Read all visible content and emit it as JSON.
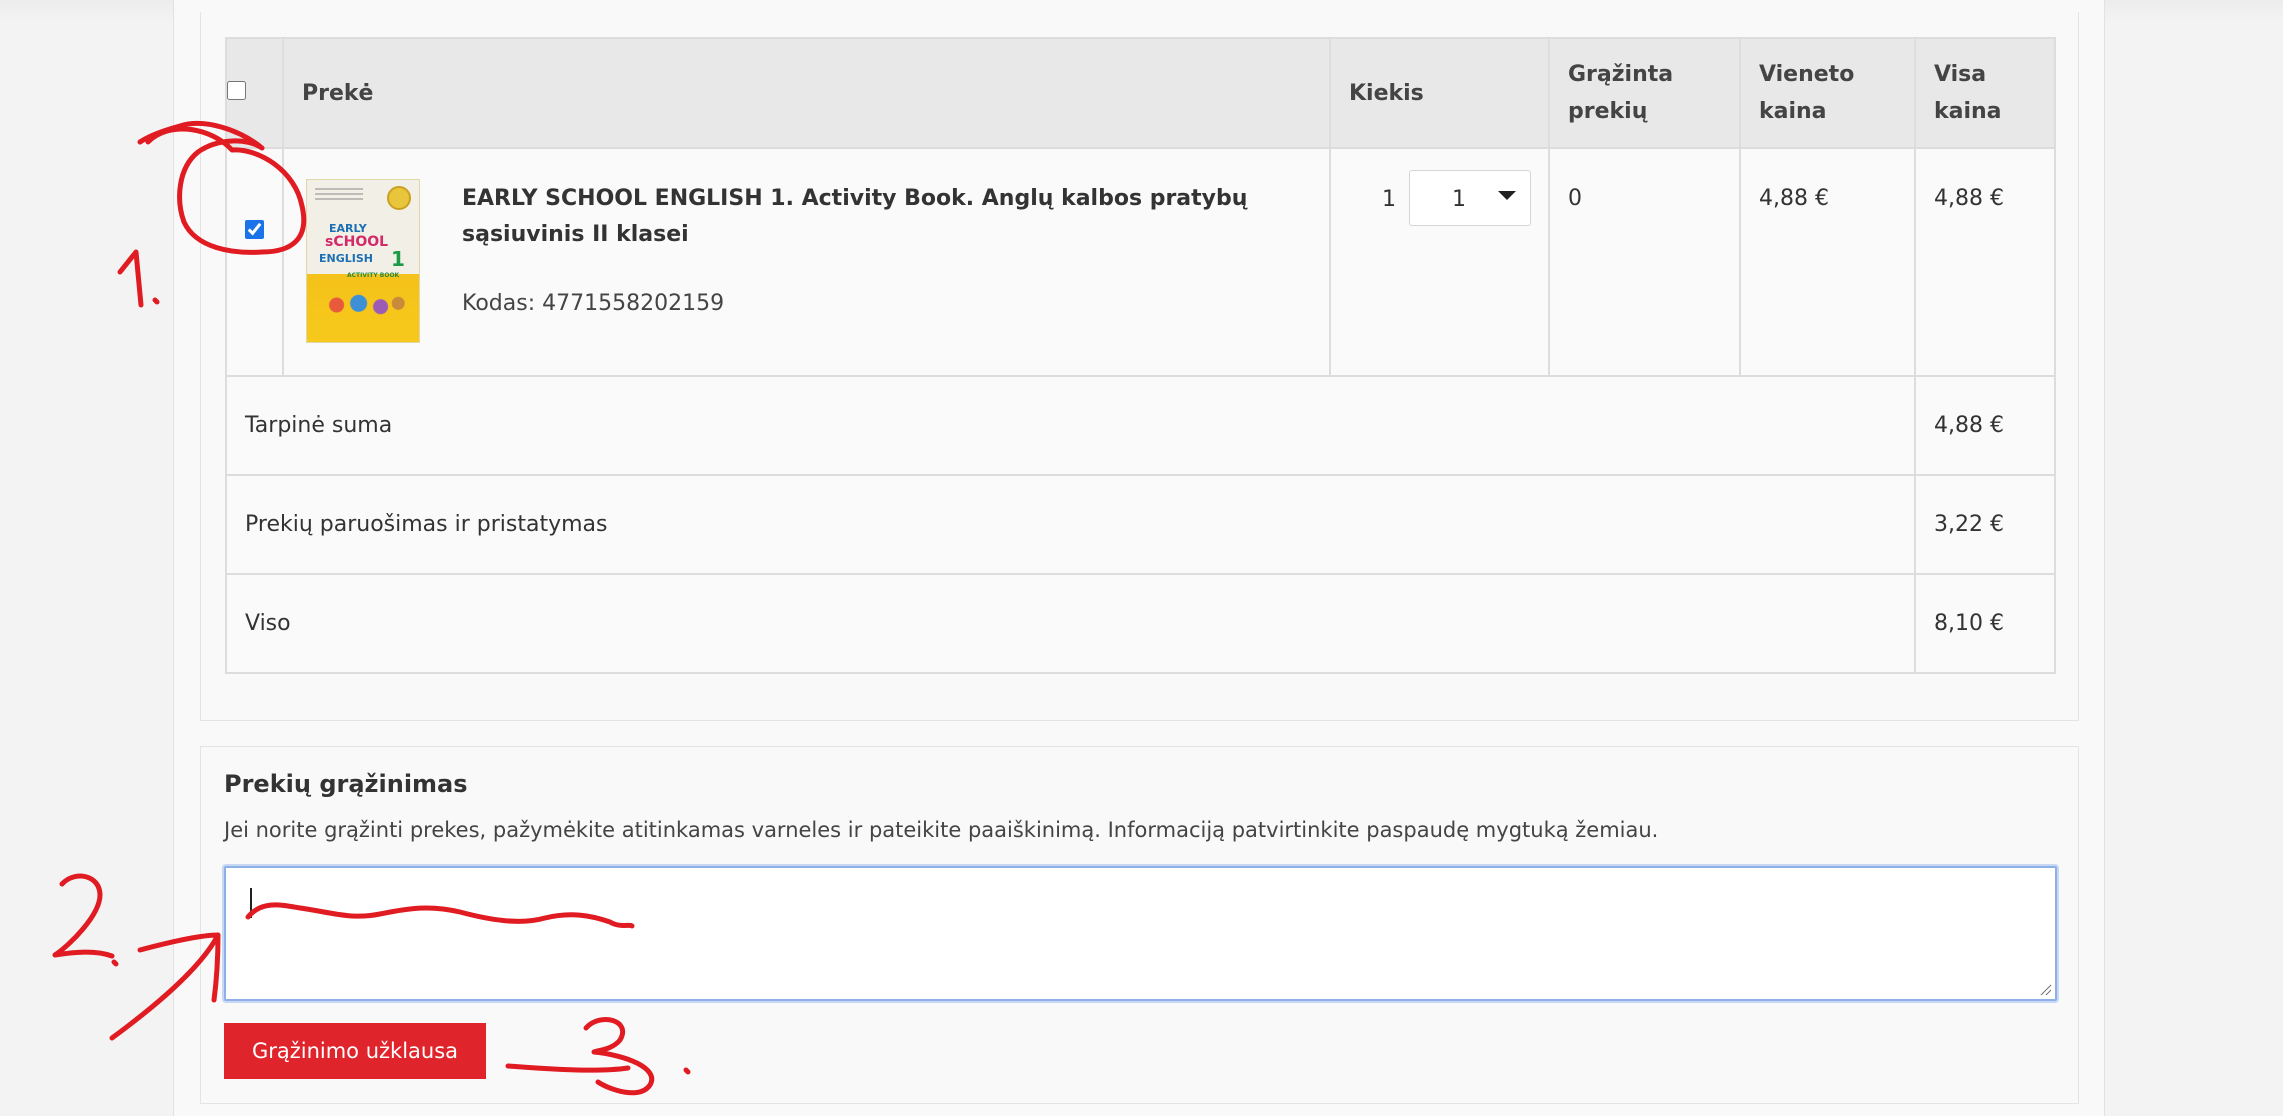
{
  "order_table": {
    "headers": {
      "product": "Prekė",
      "quantity": "Kiekis",
      "returned_line1": "Grąžinta",
      "returned_line2": "prekių",
      "unit_line1": "Vieneto",
      "unit_line2": "kaina",
      "total_line1": "Visa",
      "total_line2": "kaina"
    },
    "items": [
      {
        "selected": true,
        "name": "EARLY SCHOOL ENGLISH 1. Activity Book. Anglų kalbos pratybų sąsiuvinis II klasei",
        "code": "Kodas: 4771558202159",
        "quantity": "1",
        "return_quantity": "1",
        "returned": "0",
        "unit_price": "4,88 €",
        "total_price": "4,88 €",
        "cover": {
          "line1": "EARLY",
          "line2": "sCHOOL",
          "line3": "ENGLISH",
          "number": "1",
          "subtitle": "ACTIVITY BOOK"
        }
      }
    ],
    "summary": [
      {
        "label": "Tarpinė suma",
        "value": "4,88 €"
      },
      {
        "label": "Prekių paruošimas ir pristatymas",
        "value": "3,22 €"
      },
      {
        "label": "Viso",
        "value": "8,10 €"
      }
    ]
  },
  "returns": {
    "title": "Prekių grąžinimas",
    "description": "Jei norite grąžinti prekes, pažymėkite atitinkamas varneles ir pateikite paaiškinimą. Informaciją patvirtinkite paspaudę mygtuką žemiau.",
    "textarea_value": "",
    "button_label": "Grąžinimo užklausa"
  },
  "annotations": {
    "color": "#e01b22",
    "step1": "1.",
    "step2": "2.",
    "step3": "3."
  },
  "colors": {
    "button_bg": "#e0242b",
    "checkbox_accent": "#1a73e8",
    "header_bg": "#e8e8e8"
  }
}
